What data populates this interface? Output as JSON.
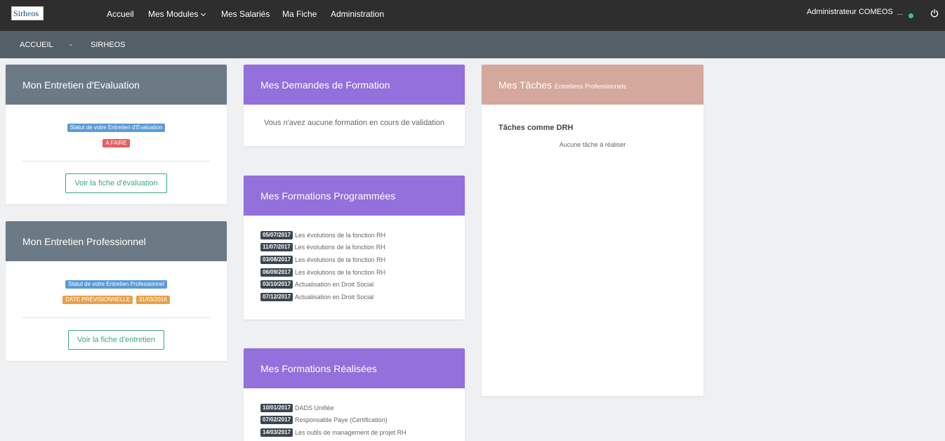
{
  "header": {
    "logo_text": "Sirheos",
    "nav": [
      "Accueil",
      "Mes Modules",
      "Mes Salariés",
      "Ma Fiche",
      "Administration"
    ],
    "user": "Administrateur COMEOS",
    "user_more": "..."
  },
  "breadcrumb": [
    "ACCUEIL",
    "-",
    "SIRHEOS"
  ],
  "colors": {
    "status_online": "#3dc47e",
    "head_gray": "#6c7a85",
    "head_purple": "#9370db",
    "head_rose": "#d4a89c"
  },
  "icons": {
    "power": "power-icon",
    "chevron": "chevron-down-icon"
  },
  "eval_card": {
    "title": "Mon Entretien d'Evaluation",
    "status_label": "Statut de votre Entretien d'Évaluation",
    "status_value": "A FAIRE",
    "button": "Voir la fiche d'évaluation"
  },
  "pro_card": {
    "title": "Mon Entretien Professionnel",
    "status_label": "Statut de votre Entretien Professionnel",
    "status_value": "DATE PRÉVISIONNELLE",
    "status_date": "31/03/2016",
    "button": "Voir la fiche d'entretien"
  },
  "demandes_card": {
    "title": "Mes Demandes de Formation",
    "empty": "Vous n'avez aucune formation en cours de validation"
  },
  "programmees_card": {
    "title": "Mes Formations Programmées",
    "items": [
      {
        "date": "05/07/2017",
        "label": "Les évolutions de la fonction RH"
      },
      {
        "date": "11/07/2017",
        "label": "Les évolutions de la fonction RH"
      },
      {
        "date": "03/08/2017",
        "label": "Les évolutions de la fonction RH"
      },
      {
        "date": "06/09/2017",
        "label": "Les évolutions de la fonction RH"
      },
      {
        "date": "03/10/2017",
        "label": "Actualisation en Droit Social"
      },
      {
        "date": "07/12/2017",
        "label": "Actualisation en Droit Social"
      }
    ]
  },
  "realisees_card": {
    "title": "Mes Formations Réalisées",
    "items": [
      {
        "date": "10/01/2017",
        "label": "DADS Unifiée"
      },
      {
        "date": "07/02/2017",
        "label": "Responsable Paye (Certification)"
      },
      {
        "date": "14/03/2017",
        "label": "Les outils de management de projet RH"
      }
    ]
  },
  "taches_card": {
    "title": "Mes Tâches",
    "subtitle": "Entretiens Professionnels",
    "section": "Tâches comme DRH",
    "empty": "Aucune tâche à réaliser"
  }
}
